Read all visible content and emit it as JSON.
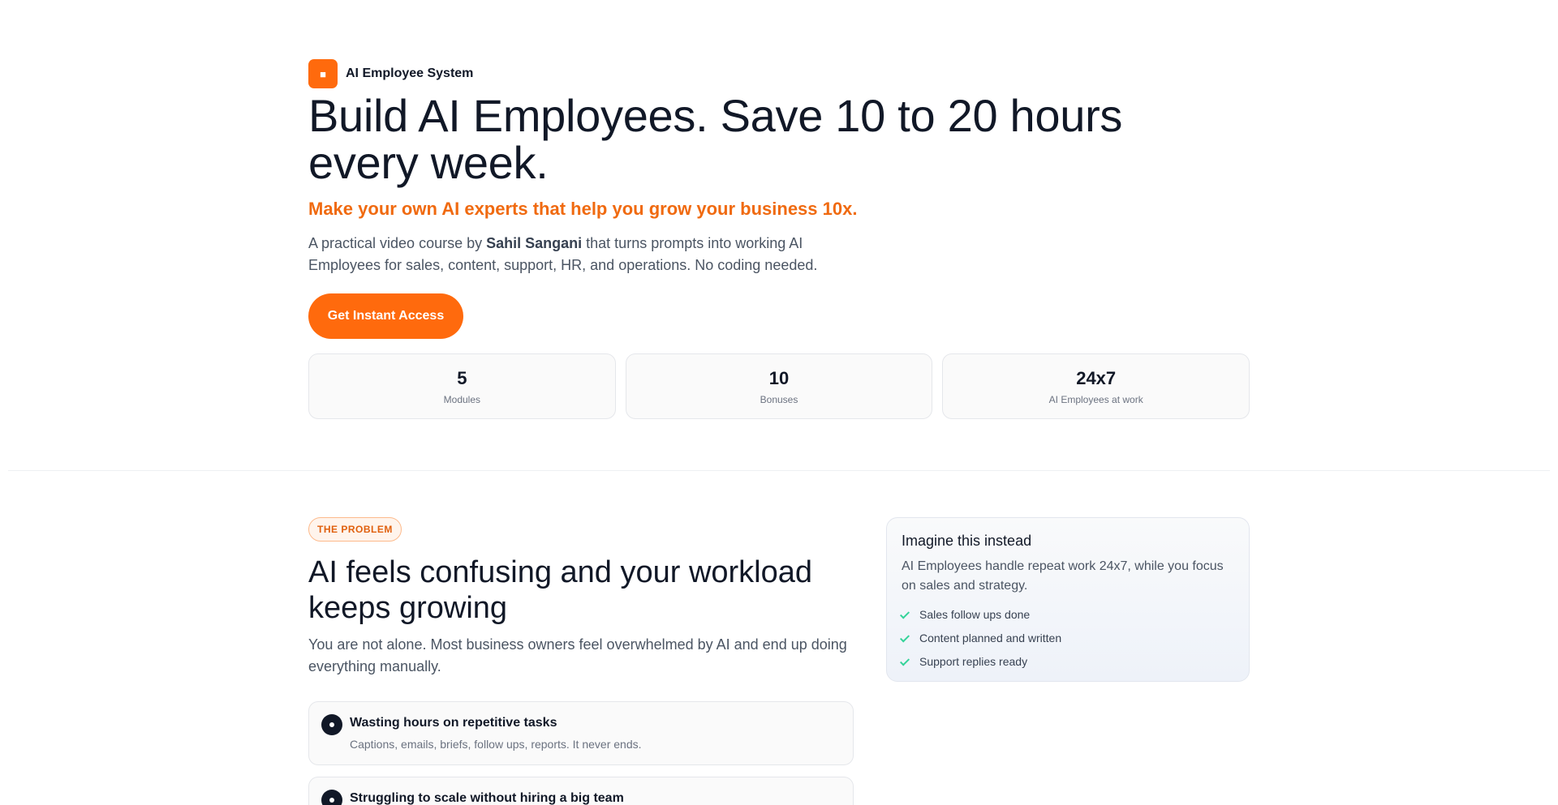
{
  "brand": {
    "name": "AI Employee System",
    "icon": "flame-icon"
  },
  "hero": {
    "title": "Build AI Employees. Save 10 to 20 hours every week.",
    "subtitle": "Make your own AI experts that help you grow your business 10x.",
    "desc_prefix": "A practical video course by ",
    "desc_author": "Sahil Sangani",
    "desc_suffix": " that turns prompts into working AI Employees for sales, content, support, HR, and operations. No coding needed.",
    "cta_label": "Get Instant Access"
  },
  "stats": [
    {
      "value": "5",
      "label": "Modules"
    },
    {
      "value": "10",
      "label": "Bonuses"
    },
    {
      "value": "24x7",
      "label": "AI Employees at work"
    }
  ],
  "problem": {
    "badge": "THE PROBLEM",
    "title": "AI feels confusing and your workload keeps growing",
    "desc": "You are not alone. Most business owners feel overwhelmed by AI and end up doing everything manually.",
    "cards": [
      {
        "title": "Wasting hours on repetitive tasks",
        "desc": "Captions, emails, briefs, follow ups, reports. It never ends."
      },
      {
        "title": "Struggling to scale without hiring a big team",
        "desc": ""
      }
    ]
  },
  "imagine": {
    "title": "Imagine this instead",
    "desc": "AI Employees handle repeat work 24x7, while you focus on sales and strategy.",
    "items": [
      "Sales follow ups done",
      "Content planned and written",
      "Support replies ready"
    ]
  },
  "colors": {
    "accent": "#ff6a0d",
    "accent_text": "#f06a10",
    "check": "#34d399",
    "dark": "#111827"
  }
}
